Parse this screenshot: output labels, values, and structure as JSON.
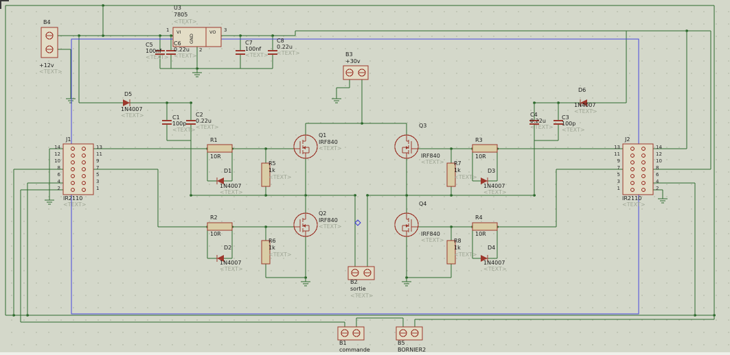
{
  "sheet": {
    "background": "#d4d8ca",
    "wire_color": "#2d6a2d",
    "component_color": "#9c372c",
    "selection_color": "#4646dd",
    "text_color": "#1b1b1b",
    "placeholder_color": "#9fa695"
  },
  "components": {
    "u3": {
      "ref": "U3",
      "value": "7805",
      "text": "<TEXT>",
      "pins": {
        "vi": "VI",
        "vo": "VO",
        "gnd": "GND",
        "n1": "1",
        "n2": "2",
        "n3": "3"
      }
    },
    "b4": {
      "ref": "B4",
      "value": "+12v",
      "text": "<TEXT>"
    },
    "b3": {
      "ref": "B3",
      "value": "+30v"
    },
    "b2": {
      "ref": "B2",
      "value": "sortie",
      "text": "<TEXT>"
    },
    "b1": {
      "ref": "B1",
      "value": "commande"
    },
    "b5": {
      "ref": "B5",
      "value": "BORNIER2"
    },
    "c1": {
      "ref": "C1",
      "value": "100p",
      "text": "<TEXT>"
    },
    "c2": {
      "ref": "C2",
      "value": "0.22u",
      "text": "<TEXT>"
    },
    "c3": {
      "ref": "C3",
      "value": "100p",
      "text": "<TEXT>"
    },
    "c4": {
      "ref": "C4",
      "value": "0.22u",
      "text": "<TEXT>"
    },
    "c5": {
      "ref": "C5",
      "value": "100nf",
      "text": "<TEXT>"
    },
    "c6": {
      "ref": "C6",
      "value": "0.22u",
      "text": "<TEXT>"
    },
    "c7": {
      "ref": "C7",
      "value": "100nf",
      "text": "<TEXT>"
    },
    "c8": {
      "ref": "C8",
      "value": "0.22u",
      "text": "<TEXT>"
    },
    "d1": {
      "ref": "D1",
      "value": "1N4007",
      "text": "<TEXT>"
    },
    "d2": {
      "ref": "D2",
      "value": "1N4007",
      "text": "<TEXT>"
    },
    "d3": {
      "ref": "D3",
      "value": "1N4007",
      "text": "<TEXT>"
    },
    "d4": {
      "ref": "D4",
      "value": "1N4007",
      "text": "<TEXT>"
    },
    "d5": {
      "ref": "D5",
      "value": "1N4007",
      "text": "<TEXT>"
    },
    "d6": {
      "ref": "D6",
      "value": "1N4007",
      "text": "<TEXT>"
    },
    "r1": {
      "ref": "R1",
      "value": "10R"
    },
    "r2": {
      "ref": "R2",
      "value": "10R"
    },
    "r3": {
      "ref": "R3",
      "value": "10R"
    },
    "r4": {
      "ref": "R4",
      "value": "10R"
    },
    "r5": {
      "ref": "R5",
      "value": "1k",
      "text": "<TEXT>"
    },
    "r6": {
      "ref": "R6",
      "value": "1k",
      "text": "<TEXT>"
    },
    "r7": {
      "ref": "R7",
      "value": "1k",
      "text": "<TEXT>"
    },
    "r8": {
      "ref": "R8",
      "value": "1k",
      "text": "<TEXT>"
    },
    "q1": {
      "ref": "Q1",
      "value": "IRF840",
      "text": "<TEXT>"
    },
    "q2": {
      "ref": "Q2",
      "value": "IRF840",
      "text": "<TEXT>"
    },
    "q3": {
      "ref": "Q3",
      "value": "IRF840",
      "text": "<TEXT>"
    },
    "q4": {
      "ref": "Q4",
      "value": "IRF840",
      "text": "<TEXT>"
    },
    "j1": {
      "ref": "J1",
      "value": "IR2110",
      "text": "<TEXT>",
      "left_pins": [
        "14",
        "12",
        "10",
        "8",
        "6",
        "4",
        "2"
      ],
      "right_pins": [
        "13",
        "11",
        "9",
        "7",
        "5",
        "3",
        "1"
      ]
    },
    "j2": {
      "ref": "J2",
      "value": "IR2110",
      "text": "<TEXT>",
      "left_pins": [
        "13",
        "11",
        "9",
        "7",
        "5",
        "3",
        "1"
      ],
      "right_pins": [
        "14",
        "12",
        "10",
        "8",
        "6",
        "4",
        "2"
      ]
    }
  }
}
